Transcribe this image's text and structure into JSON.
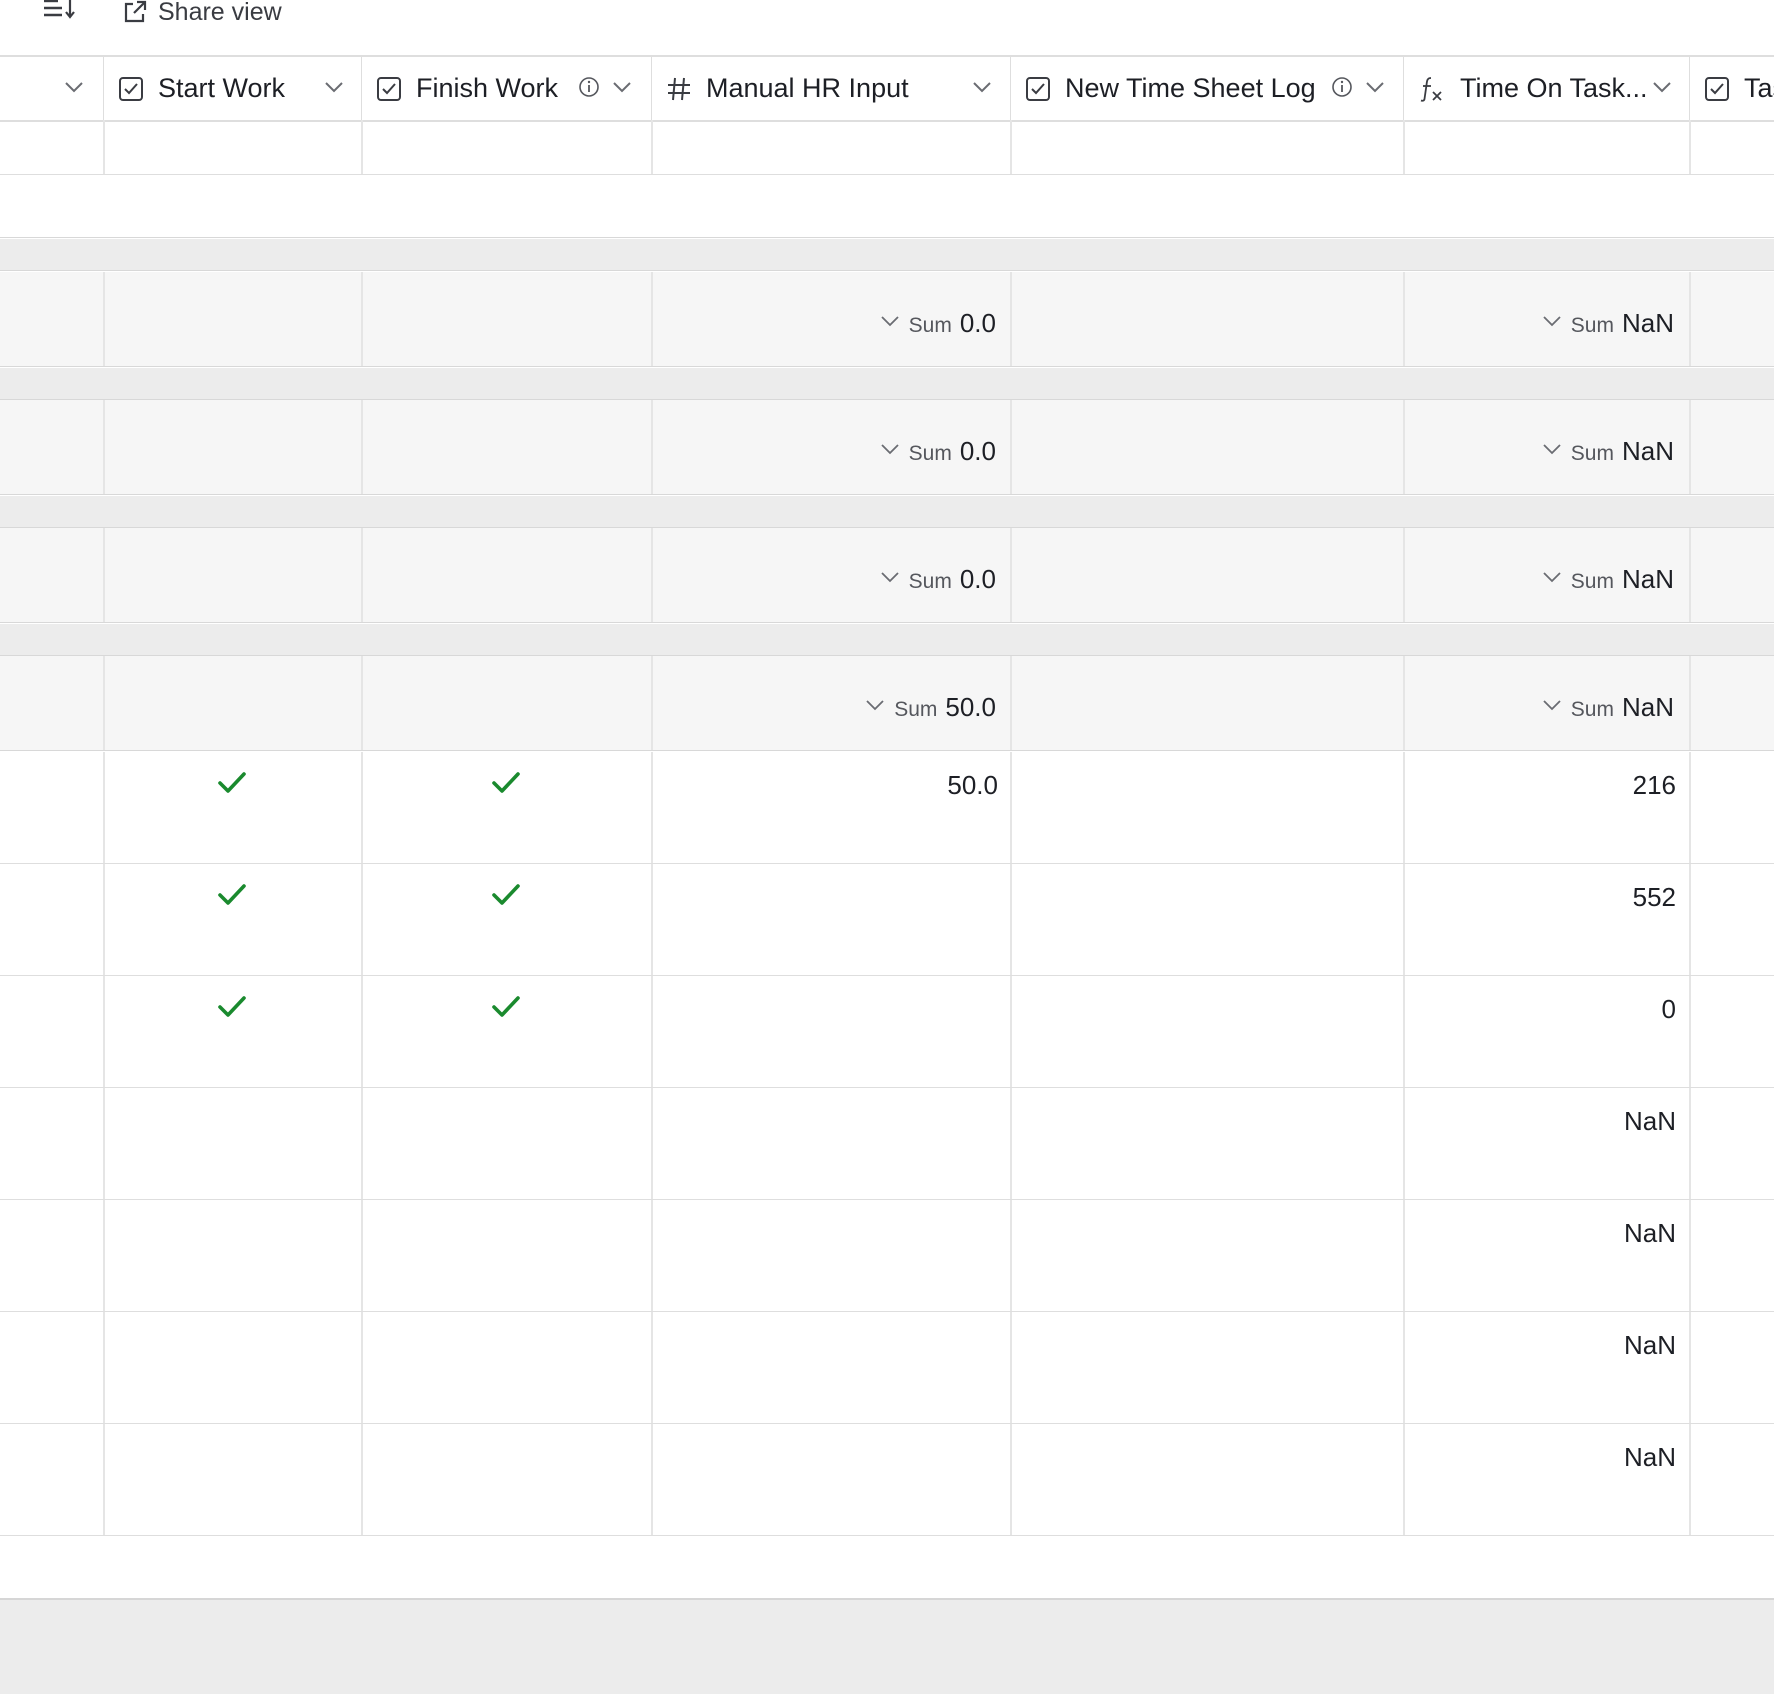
{
  "toolbar": {
    "sort_icon": "sort-lines-icon",
    "share_icon": "external-link-icon",
    "share_label": "Share view"
  },
  "columns": [
    {
      "key": "prev",
      "label": "",
      "type_icon": "none"
    },
    {
      "key": "start_work",
      "label": "Start Work",
      "type_icon": "checkbox-icon"
    },
    {
      "key": "finish_work",
      "label": "Finish Work",
      "type_icon": "checkbox-icon",
      "info": true
    },
    {
      "key": "manual_hr",
      "label": "Manual HR Input",
      "type_icon": "number-icon"
    },
    {
      "key": "new_time_sheet",
      "label": "New Time Sheet Log",
      "type_icon": "checkbox-icon",
      "info": true
    },
    {
      "key": "time_on_task",
      "label": "Time On Task...",
      "type_icon": "formula-icon"
    },
    {
      "key": "next",
      "label": "Tas",
      "type_icon": "checkbox-icon"
    }
  ],
  "summaries": [
    {
      "manual_hr": {
        "label": "Sum",
        "value": "0.0"
      },
      "time_on_task": {
        "label": "Sum",
        "value": "NaN"
      }
    },
    {
      "manual_hr": {
        "label": "Sum",
        "value": "0.0"
      },
      "time_on_task": {
        "label": "Sum",
        "value": "NaN"
      }
    },
    {
      "manual_hr": {
        "label": "Sum",
        "value": "0.0"
      },
      "time_on_task": {
        "label": "Sum",
        "value": "NaN"
      }
    },
    {
      "manual_hr": {
        "label": "Sum",
        "value": "50.0"
      },
      "time_on_task": {
        "label": "Sum",
        "value": "NaN"
      }
    }
  ],
  "records": [
    {
      "start_work": true,
      "finish_work": true,
      "manual_hr": "50.0",
      "time_on_task": "216"
    },
    {
      "start_work": true,
      "finish_work": true,
      "manual_hr": "",
      "time_on_task": "552"
    },
    {
      "start_work": true,
      "finish_work": true,
      "manual_hr": "",
      "time_on_task": "0"
    },
    {
      "start_work": false,
      "finish_work": false,
      "manual_hr": "",
      "time_on_task": "NaN"
    },
    {
      "start_work": false,
      "finish_work": false,
      "manual_hr": "",
      "time_on_task": "NaN"
    },
    {
      "start_work": false,
      "finish_work": false,
      "manual_hr": "",
      "time_on_task": "NaN"
    },
    {
      "start_work": false,
      "finish_work": false,
      "manual_hr": "",
      "time_on_task": "NaN"
    }
  ],
  "colors": {
    "check": "#1a8a2e",
    "grid": "#e5e5e5",
    "summary_bg": "#f6f6f6",
    "group_bg": "#ececec"
  }
}
